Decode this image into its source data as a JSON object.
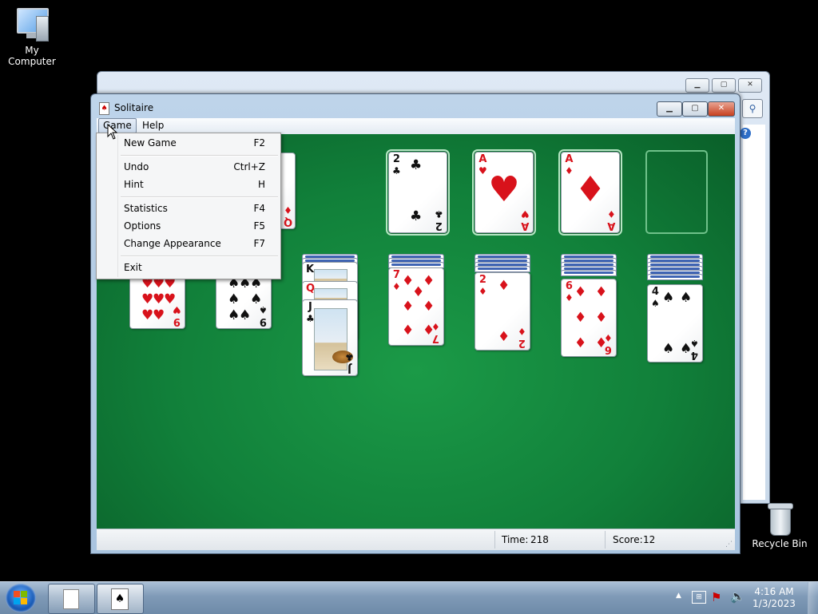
{
  "desktop": {
    "icons": [
      {
        "label": "My Computer",
        "icon": "computer-icon"
      },
      {
        "label": "Recycle Bin",
        "icon": "recycle-bin-icon"
      }
    ]
  },
  "window": {
    "title": "Solitaire",
    "controls": {
      "minimize": "▁",
      "maximize": "▢",
      "close": "✕"
    }
  },
  "menubar": {
    "game": "Game",
    "help": "Help"
  },
  "game_menu": {
    "items": [
      {
        "label": "New Game",
        "shortcut": "F2"
      },
      {
        "label": "Undo",
        "shortcut": "Ctrl+Z"
      },
      {
        "label": "Hint",
        "shortcut": "H"
      },
      {
        "label": "Statistics",
        "shortcut": "F4"
      },
      {
        "label": "Options",
        "shortcut": "F5"
      },
      {
        "label": "Change Appearance",
        "shortcut": "F7"
      },
      {
        "label": "Exit",
        "shortcut": ""
      }
    ]
  },
  "foundations": [
    {
      "rank": "2",
      "suit": "♣",
      "color": "black"
    },
    {
      "rank": "A",
      "suit": "♥",
      "color": "red"
    },
    {
      "rank": "A",
      "suit": "♦",
      "color": "red"
    },
    {
      "rank": "",
      "suit": "",
      "color": "empty"
    }
  ],
  "waste_top": {
    "rank": "Q",
    "suit": "♦"
  },
  "tableau": [
    {
      "rank": "9",
      "suit": "♥"
    },
    {
      "rank": "9",
      "suit": "♠"
    },
    {
      "stack": [
        {
          "rank": "K",
          "suit": "♥"
        },
        {
          "rank": "Q",
          "suit": "♥"
        },
        {
          "rank": "J",
          "suit": "♣"
        }
      ]
    },
    {
      "rank": "7",
      "suit": "♦"
    },
    {
      "rank": "2",
      "suit": "♦"
    },
    {
      "rank": "6",
      "suit": "♦"
    },
    {
      "rank": "4",
      "suit": "♠"
    }
  ],
  "status": {
    "time_label": "Time:",
    "time_value": "218",
    "score_label": "Score:",
    "score_value": "12"
  },
  "taskbar": {
    "clock_time": "4:16 AM",
    "clock_date": "1/3/2023"
  },
  "colors": {
    "felt": "#11803a",
    "red_suit": "#d8121b",
    "black_suit": "#111111"
  }
}
